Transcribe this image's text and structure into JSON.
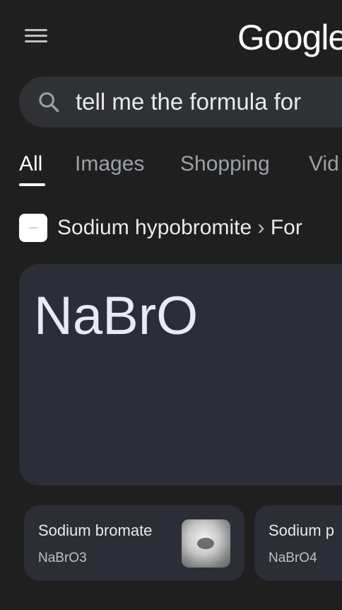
{
  "header": {
    "logo_text": "Google"
  },
  "search": {
    "query": "tell me the formula for"
  },
  "tabs": [
    {
      "label": "All",
      "active": true
    },
    {
      "label": "Images",
      "active": false
    },
    {
      "label": "Shopping",
      "active": false
    },
    {
      "label": "Vid",
      "active": false
    }
  ],
  "source": {
    "title": "Sodium hypobromite",
    "separator": "›",
    "section": "For"
  },
  "answer": {
    "formula": "NaBrO"
  },
  "related": [
    {
      "title": "Sodium bromate",
      "formula": "NaBrO3"
    },
    {
      "title": "Sodium p",
      "formula": "NaBrO4"
    }
  ],
  "colors": {
    "background": "#1f1f1f",
    "card": "#2b2e36",
    "search_bar": "#303134",
    "text_primary": "#e8eaed",
    "text_secondary": "#9aa0a6"
  }
}
